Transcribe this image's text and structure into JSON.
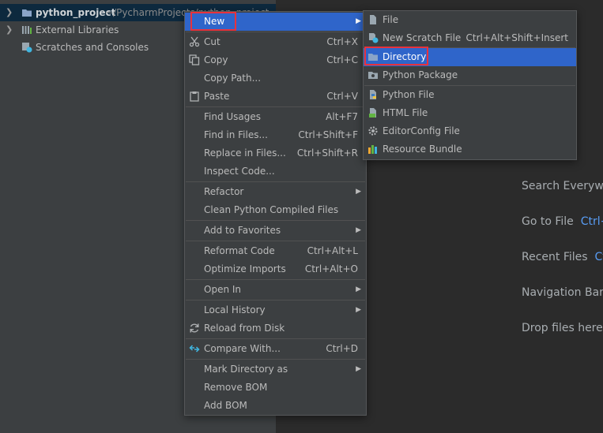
{
  "project_tree": {
    "root_name": "python_project",
    "root_path": "~/PycharmProjects/python_project",
    "items": [
      {
        "label": "External Libraries"
      },
      {
        "label": "Scratches and Consoles"
      }
    ]
  },
  "editor_hints": [
    {
      "label": "Search Everywhe",
      "shortcut": ""
    },
    {
      "label": "Go to File",
      "shortcut": "Ctrl+S"
    },
    {
      "label": "Recent Files",
      "shortcut": "Ctr"
    },
    {
      "label": "Navigation Bar",
      "shortcut": ""
    },
    {
      "label": "Drop files here t",
      "shortcut": ""
    }
  ],
  "context_menu": {
    "items": [
      {
        "label": "New",
        "shortcut": "",
        "submenu": true
      },
      {
        "label": "Cut",
        "shortcut": "Ctrl+X"
      },
      {
        "label": "Copy",
        "shortcut": "Ctrl+C"
      },
      {
        "label": "Copy Path...",
        "shortcut": ""
      },
      {
        "label": "Paste",
        "shortcut": "Ctrl+V"
      },
      {
        "label": "Find Usages",
        "shortcut": "Alt+F7"
      },
      {
        "label": "Find in Files...",
        "shortcut": "Ctrl+Shift+F"
      },
      {
        "label": "Replace in Files...",
        "shortcut": "Ctrl+Shift+R"
      },
      {
        "label": "Inspect Code...",
        "shortcut": ""
      },
      {
        "label": "Refactor",
        "shortcut": "",
        "submenu": true
      },
      {
        "label": "Clean Python Compiled Files",
        "shortcut": ""
      },
      {
        "label": "Add to Favorites",
        "shortcut": "",
        "submenu": true
      },
      {
        "label": "Reformat Code",
        "shortcut": "Ctrl+Alt+L"
      },
      {
        "label": "Optimize Imports",
        "shortcut": "Ctrl+Alt+O"
      },
      {
        "label": "Open In",
        "shortcut": "",
        "submenu": true
      },
      {
        "label": "Local History",
        "shortcut": "",
        "submenu": true
      },
      {
        "label": "Reload from Disk",
        "shortcut": ""
      },
      {
        "label": "Compare With...",
        "shortcut": "Ctrl+D"
      },
      {
        "label": "Mark Directory as",
        "shortcut": "",
        "submenu": true
      },
      {
        "label": "Remove BOM",
        "shortcut": ""
      },
      {
        "label": "Add BOM",
        "shortcut": ""
      }
    ]
  },
  "new_submenu": {
    "items": [
      {
        "label": "File",
        "shortcut": ""
      },
      {
        "label": "New Scratch File",
        "shortcut": "Ctrl+Alt+Shift+Insert"
      },
      {
        "label": "Directory",
        "shortcut": ""
      },
      {
        "label": "Python Package",
        "shortcut": ""
      },
      {
        "label": "Python File",
        "shortcut": ""
      },
      {
        "label": "HTML File",
        "shortcut": ""
      },
      {
        "label": "EditorConfig File",
        "shortcut": ""
      },
      {
        "label": "Resource Bundle",
        "shortcut": ""
      }
    ]
  },
  "colors": {
    "selection": "#2f65ca",
    "highlight_box": "#e8323c",
    "menu_bg": "#3c3f41",
    "editor_bg": "#2b2b2b"
  }
}
